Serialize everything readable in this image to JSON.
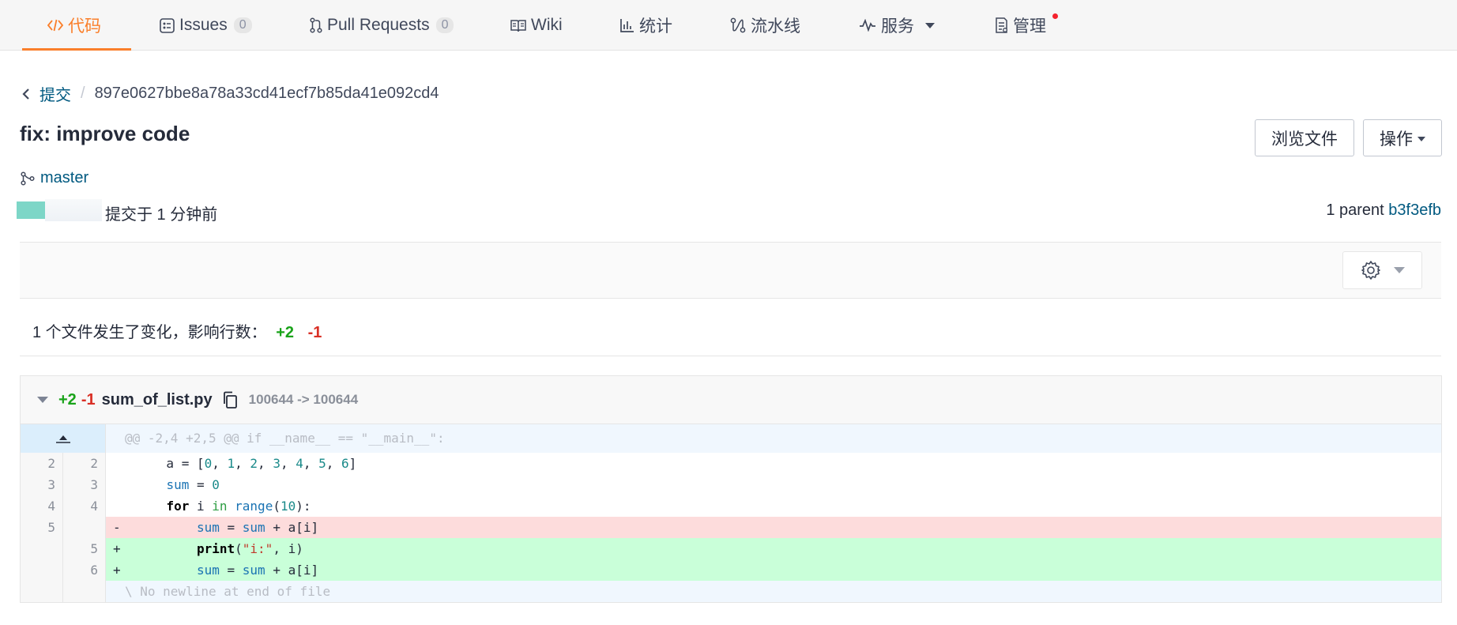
{
  "nav": {
    "tabs": [
      {
        "label": "代码"
      },
      {
        "label": "Issues",
        "count": "0"
      },
      {
        "label": "Pull Requests",
        "count": "0"
      },
      {
        "label": "Wiki"
      },
      {
        "label": "统计"
      },
      {
        "label": "流水线"
      },
      {
        "label": "服务"
      },
      {
        "label": "管理"
      }
    ]
  },
  "breadcrumb": {
    "parent": "提交",
    "separator": "/",
    "sha": "897e0627bbe8a78a33cd41ecf7b85da41e092cd4"
  },
  "commit": {
    "title": "fix: improve code",
    "branch": "master",
    "time": "提交于 1 分钟前",
    "parent_prefix": "1 parent",
    "parent_sha": "b3f3efb"
  },
  "actions": {
    "browse": "浏览文件",
    "ops": "操作"
  },
  "summary": {
    "text": "1 个文件发生了变化，影响行数：",
    "plus": "+2",
    "minus": "-1"
  },
  "file": {
    "plus": "+2",
    "minus": "-1",
    "name": "sum_of_list.py",
    "mode": "100644 -> 100644",
    "hunk": "@@ -2,4 +2,5 @@ if __name__ == \"__main__\":",
    "lines": [
      {
        "old": "2",
        "new": "2",
        "sign": " ",
        "type": "ctx"
      },
      {
        "old": "3",
        "new": "3",
        "sign": " ",
        "type": "ctx"
      },
      {
        "old": "4",
        "new": "4",
        "sign": " ",
        "type": "ctx"
      },
      {
        "old": "5",
        "new": "",
        "sign": "-",
        "type": "del"
      },
      {
        "old": "",
        "new": "5",
        "sign": "+",
        "type": "add"
      },
      {
        "old": "",
        "new": "6",
        "sign": "+",
        "type": "add"
      }
    ],
    "eof": "\\ No newline at end of file"
  },
  "colors": {
    "accent": "#fa7f2b",
    "link": "#005980",
    "added": "#c9ffd9",
    "removed": "#fddcdc"
  }
}
